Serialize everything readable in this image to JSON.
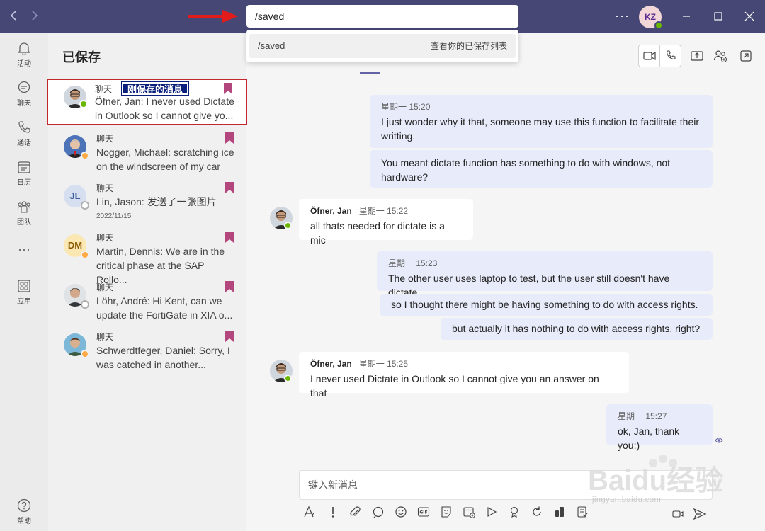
{
  "titlebar": {
    "search_value": "/saved",
    "user_initials": "KZ"
  },
  "dropdown": {
    "command": "/saved",
    "description": "查看你的已保存列表"
  },
  "rail": [
    {
      "label": "活动",
      "icon": "bell-icon"
    },
    {
      "label": "聊天",
      "icon": "chat-icon"
    },
    {
      "label": "通话",
      "icon": "phone-icon"
    },
    {
      "label": "日历",
      "icon": "calendar-icon"
    },
    {
      "label": "团队",
      "icon": "teams-icon"
    },
    {
      "label": "应用",
      "icon": "apps-icon"
    },
    {
      "label": "帮助",
      "icon": "help-icon"
    }
  ],
  "saved": {
    "title": "已保存",
    "annotation": "刚保存的消息",
    "items": [
      {
        "type": "聊天",
        "text": "Öfner, Jan: I never used Dictate in Outlook so I cannot give yo...",
        "initials": "",
        "date": ""
      },
      {
        "type": "聊天",
        "text": "Nogger, Michael: scratching ice on the windscreen of my car",
        "initials": "",
        "date": ""
      },
      {
        "type": "聊天",
        "text": "Lin, Jason: 发送了一张图片",
        "initials": "JL",
        "date": "2022/11/15"
      },
      {
        "type": "聊天",
        "text": "Martin, Dennis: We are in the critical phase at the SAP Rollo...",
        "initials": "DM",
        "date": ""
      },
      {
        "type": "聊天",
        "text": "Löhr, André: Hi Kent, can we update the FortiGate in XIA o...",
        "initials": "",
        "date": ""
      },
      {
        "type": "聊天",
        "text": "Schwerdtfeger, Daniel: Sorry, I was catched in another...",
        "initials": "",
        "date": ""
      }
    ]
  },
  "messages": [
    {
      "meta": "星期一 15:20",
      "text": "I just wonder why it that, someone may use this function to facilitate their writting."
    },
    {
      "text": "You meant dictate function has something to do with windows, not hardware?"
    },
    {
      "author": "Öfner, Jan",
      "meta": "星期一 15:22",
      "text": "all thats needed for dictate is a mic"
    },
    {
      "meta": "星期一 15:23",
      "text": "The other user uses laptop to test, but the user still doesn't have dictate"
    },
    {
      "text": "so I thought there might be having something to do with access rights."
    },
    {
      "text": "but actually it has nothing to do with access rights, right?"
    },
    {
      "author": "Öfner, Jan",
      "meta": "星期一 15:25",
      "text": "I never used Dictate in Outlook so I cannot give you an answer on that"
    },
    {
      "meta": "星期一 15:27",
      "text": "ok, Jan, thank you:)"
    }
  ],
  "compose": {
    "placeholder": "键入新消息"
  },
  "watermark": {
    "brand": "Baidu经验",
    "url": "jingyan.baidu.com"
  },
  "colors": {
    "titlebar": "#464775",
    "accent": "#6264a7",
    "bookmark": "#b4467e",
    "highlight_border": "#c4262e",
    "annotation_bg": "#0a1e7c",
    "available": "#6bb700",
    "away": "#ffaa44"
  }
}
